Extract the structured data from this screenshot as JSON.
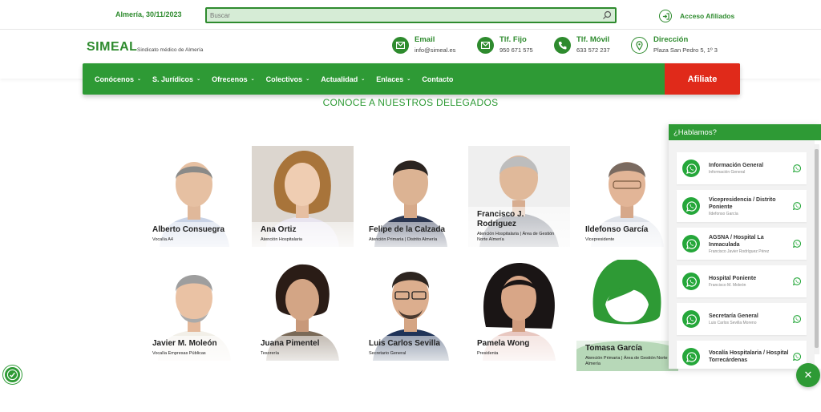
{
  "topbar": {
    "date": "Almería, 30/11/2023",
    "search_placeholder": "Buscar",
    "access_label": "Acceso Afiliados"
  },
  "header": {
    "logo": "SIMEAL",
    "tagline": "Sindicato médico de Almería",
    "contacts": [
      {
        "title": "Email",
        "value": "info@simeal.es",
        "icon": "mail-icon"
      },
      {
        "title": "Tlf. Fijo",
        "value": "950 671 575",
        "icon": "mail-icon"
      },
      {
        "title": "Tlf. Móvil",
        "value": "633 572 237",
        "icon": "phone-icon"
      },
      {
        "title": "Dirección",
        "value": "Plaza San Pedro 5, 1º 3",
        "icon": "location-pin-icon"
      }
    ]
  },
  "nav": {
    "items": [
      "Conócenos",
      "S. Jurídicos",
      "Ofrecenos",
      "Colectivos",
      "Actualidad",
      "Enlaces",
      "Contacto"
    ],
    "cta": "Afiliate"
  },
  "main": {
    "heading": "CONOCE A NUESTROS DELEGADOS",
    "delegates": [
      {
        "name": "Alberto Consuegra",
        "role": "Vocalía A4"
      },
      {
        "name": "Ana Ortiz",
        "role": "Atención Hospitalaria"
      },
      {
        "name": "Felipe de la Calzada",
        "role": "Atención Primaria | Distrito Almería"
      },
      {
        "name": "Francisco J. Rodriguez",
        "role": "Atención Hospitalaria | Área de Gestión Norte Almería"
      },
      {
        "name": "Ildefonso García",
        "role": "Vicepresidente"
      },
      {
        "name": "Javier M. Moleón",
        "role": "Vocalía Empresas Públicas"
      },
      {
        "name": "Juana Pimentel",
        "role": "Tesorería"
      },
      {
        "name": "Luis Carlos Sevilla",
        "role": "Secretario General"
      },
      {
        "name": "Pamela Wong",
        "role": "Presidenta"
      },
      {
        "name": "Tomasa García",
        "role": "Atención Primaria | Área de Gestión Norte Almería"
      }
    ]
  },
  "chat": {
    "title": "¿Hablamos?",
    "entries": [
      {
        "name": "Información General",
        "sub": "Información General"
      },
      {
        "name": "Vicepresidencia / Distrito Poniente",
        "sub": "Ildefonso García"
      },
      {
        "name": "AGSNA / Hospital La Inmaculada",
        "sub": "Francisco Javier Rodríguez Pérez"
      },
      {
        "name": "Hospital Poniente",
        "sub": "Francisco M. Moleón"
      },
      {
        "name": "Secretaría General",
        "sub": "Luis Carlos Sevilla Moreno"
      },
      {
        "name": "Vocalía Hospitalaria / Hospital Torrecárdenas",
        "sub": ""
      }
    ],
    "close_label": "✕"
  },
  "colors": {
    "brand_green": "#2e9a35",
    "cta_red": "#e02a1a",
    "whatsapp_green": "#25a73a"
  }
}
